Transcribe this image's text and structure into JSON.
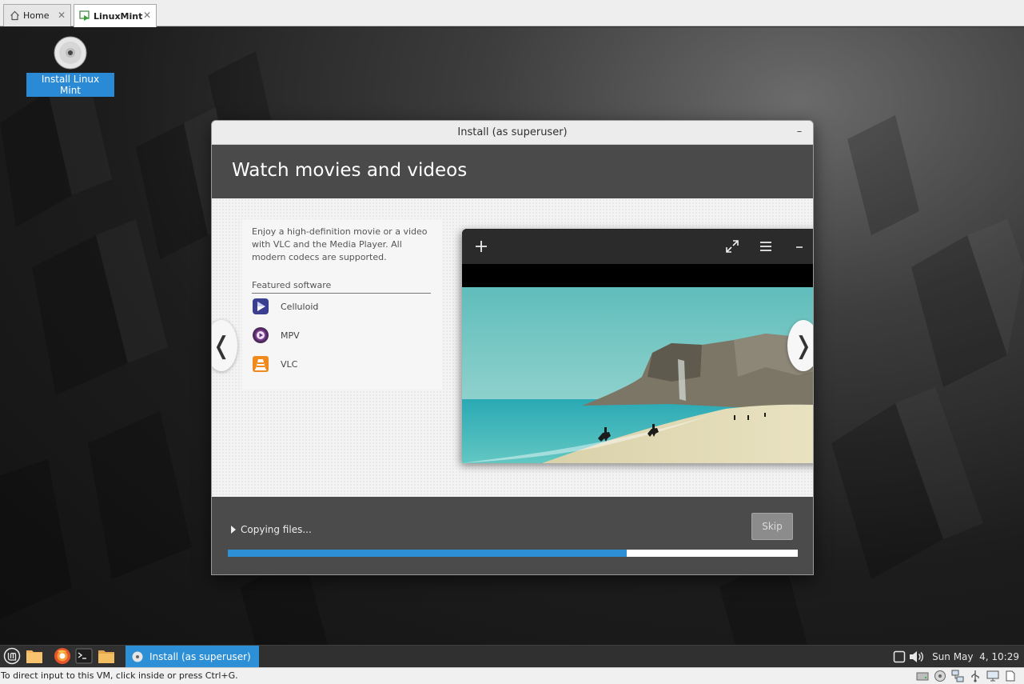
{
  "host": {
    "tabs": [
      {
        "label": "Home",
        "icon": "home-icon"
      },
      {
        "label": "LinuxMint",
        "icon": "vm-running-icon"
      }
    ],
    "status_hint": "To direct input to this VM, click inside or press Ctrl+G."
  },
  "desktop": {
    "icon_label": "Install Linux Mint"
  },
  "installer": {
    "window_title": "Install (as superuser)",
    "headline": "Watch movies and videos",
    "description": "Enjoy a high-definition movie or a video with VLC and the Media Player. All modern codecs are supported.",
    "featured_heading": "Featured software",
    "featured_apps": [
      {
        "name": "Celluloid",
        "icon": "celluloid-icon"
      },
      {
        "name": "MPV",
        "icon": "mpv-icon"
      },
      {
        "name": "VLC",
        "icon": "vlc-icon"
      }
    ],
    "prev_glyph": "❬",
    "next_glyph": "❭",
    "status_text": "Copying files...",
    "skip_label": "Skip",
    "progress_fraction": 0.7
  },
  "taskbar": {
    "task_label": "Install (as superuser)",
    "clock": "Sun May  4, 10:29"
  },
  "colors": {
    "accent": "#2d8fd5",
    "header": "#4a4a4a",
    "footer": "#4b4b4b",
    "taskbar": "#303030"
  }
}
